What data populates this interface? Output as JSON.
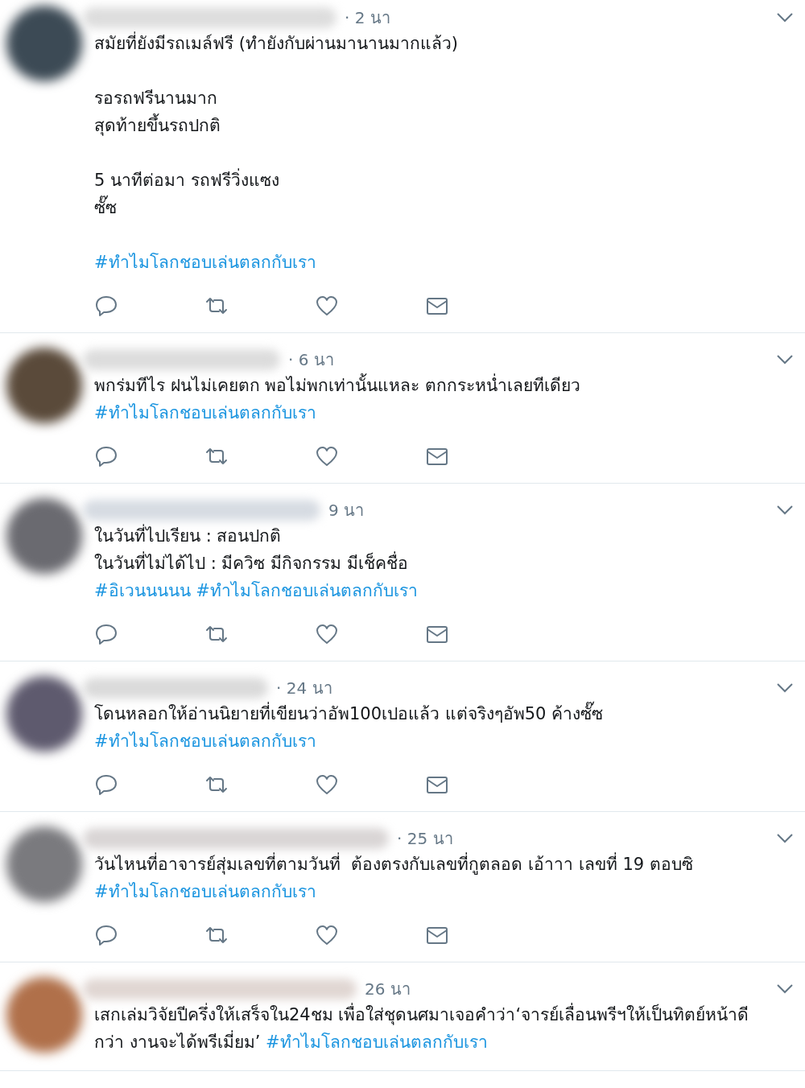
{
  "tweets": [
    {
      "time": "· 2 นา",
      "content": [
        {
          "kind": "text",
          "text": "สมัยที่ยังมีรถเมล์ฟรี (ทำยังกับผ่านมานานมากแล้ว)\n\nรอรถฟรีนานมาก\nสุดท้ายขึ้นรถปกติ\n\n5 นาทีต่อมา รถฟรีวิ่งแซง\nซั๊ซ\n\n"
        },
        {
          "kind": "hashtag",
          "text": "#ทำไมโลกชอบเล่นตลกกับเรา"
        }
      ],
      "actions": true
    },
    {
      "time": "· 6 นา",
      "content": [
        {
          "kind": "text",
          "text": "พกร่มทีไร ฝนไม่เคยตก พอไม่พกเท่านั้นแหละ ตกกระหน่ำเลยทีเดียว "
        },
        {
          "kind": "hashtag",
          "text": "#ทำไมโลกชอบเล่นตลกกับเรา"
        }
      ],
      "actions": true
    },
    {
      "time": "9 นา",
      "content": [
        {
          "kind": "text",
          "text": "ในวันที่ไปเรียน : สอนปกติ\nในวันที่ไม่ได้ไป : มีควิซ มีกิจกรรม มีเช็คชื่อ\n"
        },
        {
          "kind": "hashtag",
          "text": "#อิเวนนนนน"
        },
        {
          "kind": "hashtag",
          "text": "#ทำไมโลกชอบเล่นตลกกับเรา"
        }
      ],
      "actions": true
    },
    {
      "time": "· 24 นา",
      "content": [
        {
          "kind": "text",
          "text": "โดนหลอกให้อ่านนิยายที่เขียนว่าอัพ100เปอแล้ว แต่จริงๆอัพ50 ค้างซั๊ซ "
        },
        {
          "kind": "hashtag",
          "text": "#ทำไมโลกชอบเล่นตลกกับเรา"
        }
      ],
      "actions": true
    },
    {
      "time": "· 25 นา",
      "content": [
        {
          "kind": "text",
          "text": "วันไหนที่อาจารย์สุ่มเลขที่ตามวันที่  ต้องตรงกับเลขที่กูตลอด เอ้าาา เลขที่ 19 ตอบซิ\n"
        },
        {
          "kind": "hashtag",
          "text": "#ทำไมโลกชอบเล่นตลกกับเรา"
        }
      ],
      "actions": true
    },
    {
      "time": "26 นา",
      "content": [
        {
          "kind": "text",
          "text": "เสกเล่มวิจัยปีครึ่งให้เสร็จใน24ชม เพื่อใส่ชุดนศมาเจอคำว่า‘จารย์เลื่อนพรีฯให้เป็นทิตย์หน้าดีกว่า งานจะได้พรีเมี่ยม’ "
        },
        {
          "kind": "hashtag",
          "text": "#ทำไมโลกชอบเล่นตลกกับเรา"
        }
      ],
      "actions": false
    }
  ]
}
